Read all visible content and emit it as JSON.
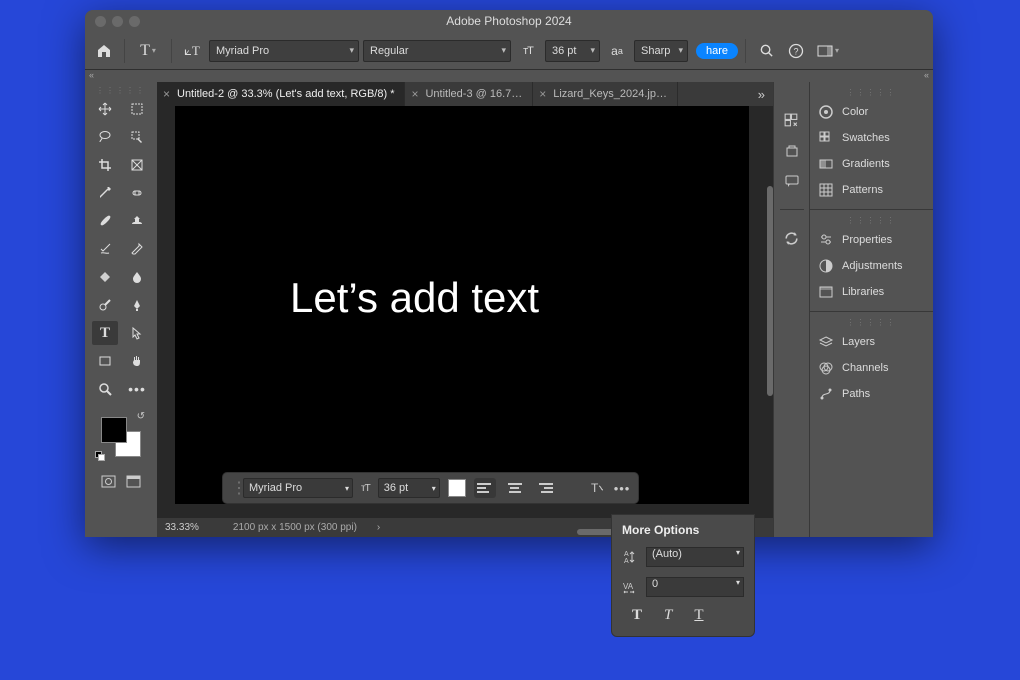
{
  "window": {
    "title": "Adobe Photoshop 2024"
  },
  "options_bar": {
    "font_family": "Myriad Pro",
    "font_style": "Regular",
    "size_label_prefix": "",
    "font_size": "36 pt",
    "anti_alias": "Sharp",
    "share_label": "hare"
  },
  "tabs": [
    {
      "label": "Untitled-2 @ 33.3% (Let's add text, RGB/8) *",
      "active": true
    },
    {
      "label": "Untitled-3 @ 16.7…",
      "active": false
    },
    {
      "label": "Lizard_Keys_2024.jp…",
      "active": false
    }
  ],
  "canvas": {
    "text": "Let’s add text"
  },
  "status": {
    "zoom": "33.33%",
    "dimensions": "2100 px x 1500 px (300 ppi)"
  },
  "right_panels": {
    "groupA": [
      "Color",
      "Swatches",
      "Gradients",
      "Patterns"
    ],
    "groupB": [
      "Properties",
      "Adjustments",
      "Libraries"
    ],
    "groupC": [
      "Layers",
      "Channels",
      "Paths"
    ]
  },
  "context_bar": {
    "font_family": "Myriad Pro",
    "font_size": "36 pt"
  },
  "more_options": {
    "title": "More Options",
    "leading": "(Auto)",
    "tracking": "0",
    "bold": "T",
    "italic": "T",
    "underline": "T"
  }
}
